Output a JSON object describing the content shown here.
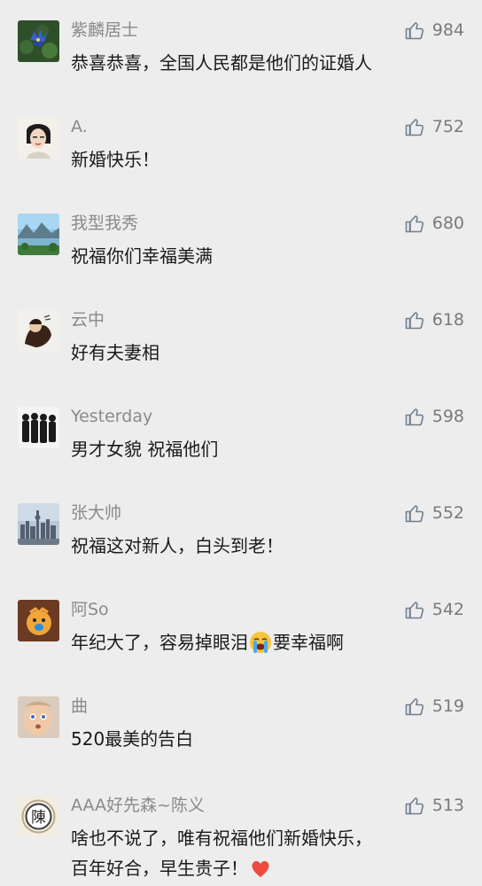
{
  "comments": [
    {
      "name": "紫麟居士",
      "likes": "984",
      "text": "恭喜恭喜，全国人民都是他们的证婚人"
    },
    {
      "name": "A.",
      "likes": "752",
      "text": "新婚快乐！"
    },
    {
      "name": "我型我秀",
      "likes": "680",
      "text": "祝福你们幸福美满"
    },
    {
      "name": "云中",
      "likes": "618",
      "text": "好有夫妻相"
    },
    {
      "name": "Yesterday",
      "likes": "598",
      "text": "男才女貌 祝福他们"
    },
    {
      "name": "张大帅",
      "likes": "552",
      "text": "祝福这对新人，白头到老！"
    },
    {
      "name": "阿So",
      "likes": "542",
      "text_a": "年纪大了，容易掉眼泪",
      "text_b": "要幸福啊"
    },
    {
      "name": "曲",
      "likes": "519",
      "text": "520最美的告白"
    },
    {
      "name": "AAA好先森~陈义",
      "likes": "513",
      "text_line1": "啥也不说了，唯有祝福他们新婚快乐，",
      "text_line2": "百年好合，早生贵子！"
    }
  ],
  "avatars": {
    "avatar_9_char": "陳"
  },
  "icons": {
    "like": "thumbs-up-outline-icon",
    "emoji_cry": "crying-face-icon",
    "emoji_heart": "red-heart-icon"
  },
  "colors": {
    "background": "#ededed",
    "name": "#8a8a8a",
    "text": "#1a1a1a",
    "like_icon": "#6f7e8f"
  }
}
